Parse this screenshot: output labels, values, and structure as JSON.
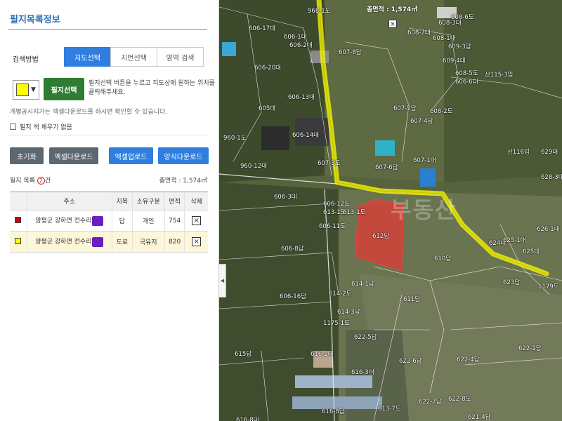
{
  "panel": {
    "title": "필지목록정보",
    "search_method_label": "검색방법",
    "tabs": [
      {
        "label": "지도선택",
        "active": true
      },
      {
        "label": "지번선택",
        "active": false
      },
      {
        "label": "영역 검색",
        "active": false
      }
    ],
    "current_color": "#ffff00",
    "select_button": "필지선택",
    "hint": "필지선택 버튼을 누르고 지도상에 원하는 위치를 클릭해주세요.",
    "excel_note": "개별공시지가는 엑셀다운로드를 하시면 확인할 수 있습니다.",
    "no_fill_label": "필지 색 채우기 없음",
    "buttons": {
      "reset": "초기화",
      "excel_download": "엑셀다운로드",
      "excel_upload": "엑셀업로드",
      "form_download": "양식다운로드"
    },
    "list_label": "필지 목록",
    "list_count": "2",
    "list_count_suffix": "건",
    "total_area": "총면적 : 1,574㎡",
    "columns": [
      "주소",
      "지목",
      "소유구분",
      "면적",
      "삭제"
    ],
    "rows": [
      {
        "color": "#cc0000",
        "address": "양평군 강하면 전수리",
        "category": "답",
        "owner": "개인",
        "area": "754",
        "delete": "×"
      },
      {
        "color": "#ffff00",
        "address": "양평군 강하면 전수리",
        "category": "도로",
        "owner": "국유지",
        "area": "820",
        "delete": "×"
      }
    ]
  },
  "map": {
    "total_area": "총면적 : 1,574㎡",
    "close": "×",
    "collapse_arrow": "◀",
    "watermark": "부동산",
    "labels": [
      "968-1도",
      "606-17대",
      "606-1대",
      "606-2대",
      "606-20대",
      "607-8답",
      "608-7대",
      "608-3대",
      "608-6도",
      "608-1대",
      "609-3답",
      "609-4대",
      "608-5도",
      "산115-3임",
      "606-6대",
      "606-13대",
      "605대",
      "607-5답",
      "607-4답",
      "608-2도",
      "606-14대",
      "960-1도",
      "960-12대",
      "607-3도",
      "607-6답",
      "607-1대",
      "산116임",
      "629대",
      "628-3대",
      "606-3대",
      "606-12도",
      "613-1도",
      "613-1도",
      "606-11도",
      "612답",
      "626-1대",
      "624대",
      "625-1대",
      "625대",
      "606-8답",
      "610답",
      "623답",
      "1179도",
      "614-1답",
      "611답",
      "606-16답",
      "614-2도",
      "614-3답",
      "1175-1도",
      "622-5답",
      "622-1답",
      "615답",
      "616-1대",
      "622-6답",
      "622-4답",
      "616-3대",
      "622-7답",
      "622-8도",
      "616-8답",
      "613-7도",
      "621-4답",
      "616-8대"
    ]
  }
}
